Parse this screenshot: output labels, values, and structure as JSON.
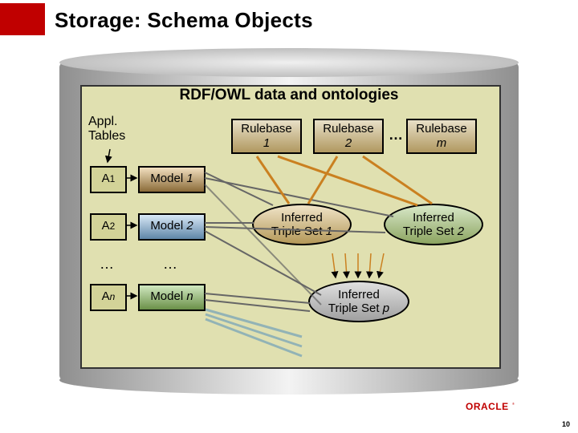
{
  "title": "Storage: Schema Objects",
  "subtitle": "RDF/OWL data and ontologies",
  "appl_label": "Appl.\nTables",
  "appl_boxes": {
    "a1": "A1",
    "a2": "A2",
    "an": "An",
    "ellipsis": "…"
  },
  "models": {
    "m1": "Model 1",
    "m2": "Model 2",
    "mn": "Model n",
    "ellipsis": "…"
  },
  "rulebases": {
    "r1_line1": "Rulebase",
    "r1_line2": "1",
    "r2_line1": "Rulebase",
    "r2_line2": "2",
    "rm_line1": "Rulebase",
    "rm_line2": "m",
    "ellipsis": "…"
  },
  "inferred": {
    "i1": "Inferred\nTriple Set 1",
    "i2": "Inferred\nTriple Set 2",
    "ip": "Inferred\nTriple Set p"
  },
  "footer": {
    "brand": "ORACLE",
    "page": "10"
  }
}
